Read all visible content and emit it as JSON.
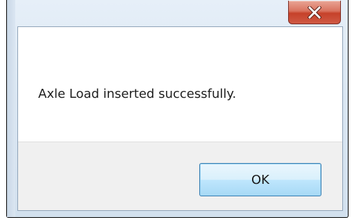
{
  "dialog": {
    "message": "Axle Load inserted successfully.",
    "ok_label": "OK",
    "close_icon": "close-x-icon"
  },
  "colors": {
    "frame": "#dbe7f3",
    "close_button": "#c6412a",
    "ok_button": "#bee6fd",
    "button_area": "#f0f0f0"
  }
}
